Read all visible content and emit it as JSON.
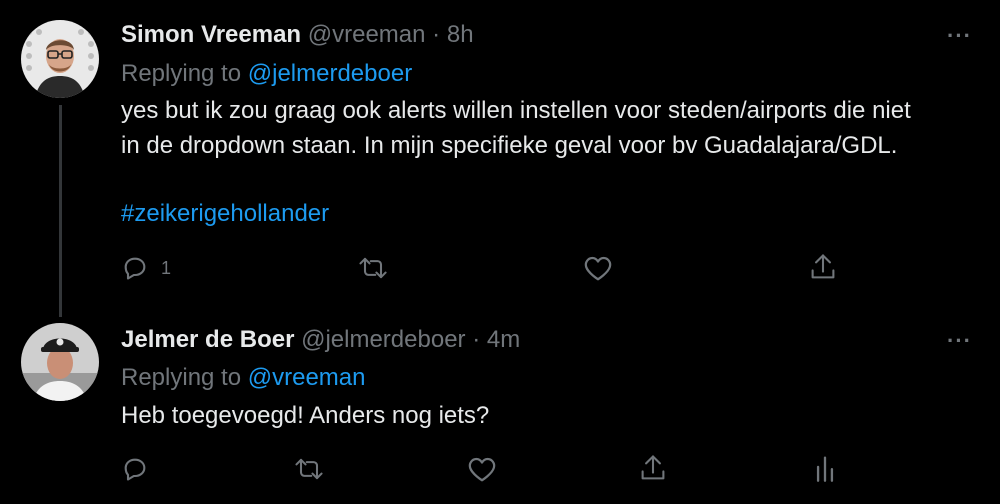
{
  "tweets": [
    {
      "name": "Simon Vreeman",
      "handle": "@vreeman",
      "separator": "·",
      "time": "8h",
      "replying_prefix": "Replying to",
      "replying_to": "@jelmerdeboer",
      "lines": [
        "yes but ik zou graag ook alerts willen instellen voor steden/airports die niet",
        "in de dropdown staan. In mijn specifieke geval voor bv Guadalajara/GDL."
      ],
      "hashtag": "#zeikerigehollander",
      "reply_count": "1",
      "more": "···"
    },
    {
      "name": "Jelmer de Boer",
      "handle": "@jelmerdeboer",
      "separator": "·",
      "time": "4m",
      "replying_prefix": "Replying to",
      "replying_to": "@vreeman",
      "lines": [
        "Heb toegevoegd! Anders nog iets?"
      ],
      "more": "···"
    }
  ],
  "icons": {
    "reply": "reply-icon",
    "retweet": "retweet-icon",
    "like": "heart-icon",
    "share": "share-icon",
    "analytics": "analytics-icon",
    "more": "more-icon"
  },
  "colors": {
    "background": "#000000",
    "text": "#e7e9ea",
    "muted": "#71767b",
    "link": "#1d9bf0",
    "thread_line": "#333639"
  }
}
